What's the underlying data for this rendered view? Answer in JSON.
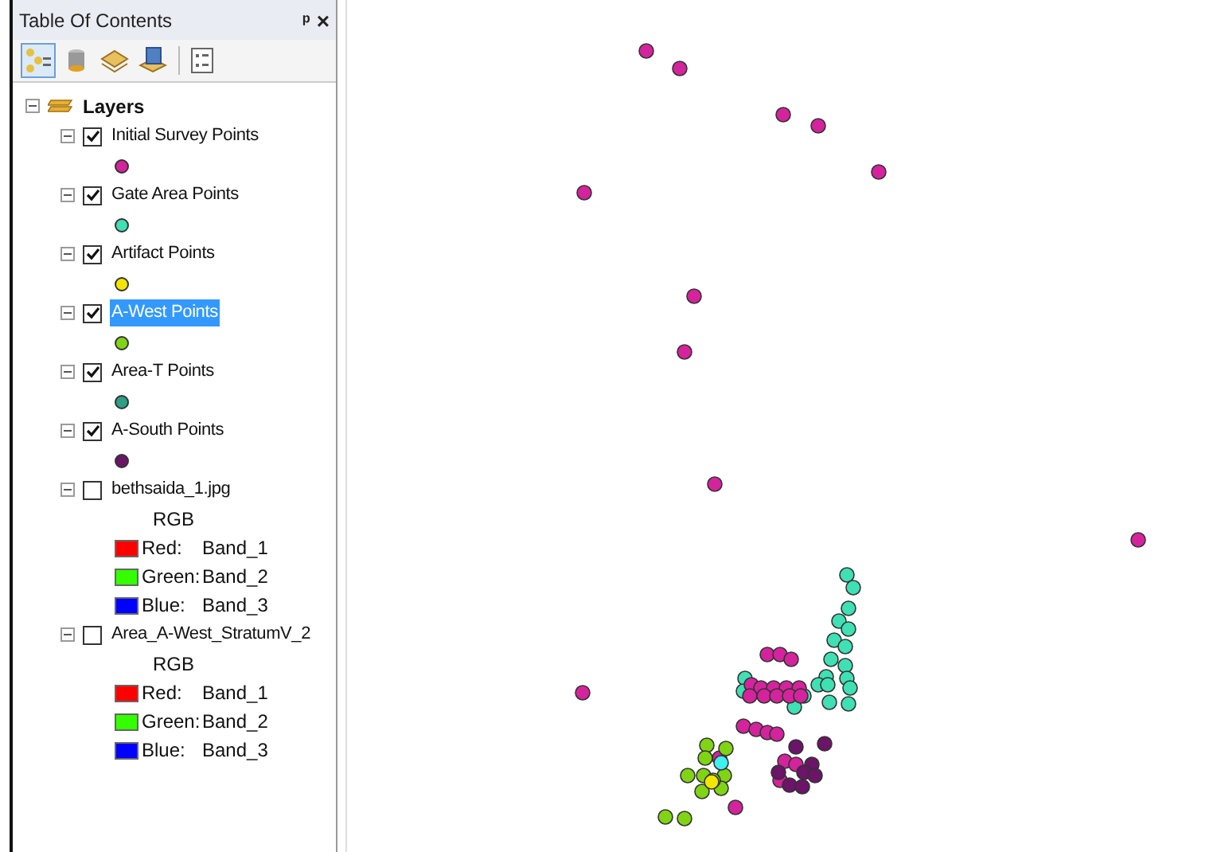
{
  "toc": {
    "title": "Table Of Contents",
    "pin": "ᵖ",
    "close": "×"
  },
  "toolbar": [
    {
      "kind": "list-by-drawing-order",
      "selected": true
    },
    {
      "kind": "list-by-source",
      "selected": false
    },
    {
      "kind": "list-by-visibility",
      "selected": false
    },
    {
      "kind": "list-by-selection",
      "selected": false
    },
    {
      "kind": "options",
      "selected": false
    }
  ],
  "root": {
    "label": "Layers",
    "expanded": true
  },
  "layers": [
    {
      "kind": "point",
      "label": "Initial Survey Points",
      "checked": true,
      "selected": false,
      "expanded": true,
      "color": "#d4239c"
    },
    {
      "kind": "point",
      "label": "Gate Area Points",
      "checked": true,
      "selected": false,
      "expanded": true,
      "color": "#3fe0b4"
    },
    {
      "kind": "point",
      "label": "Artifact Points",
      "checked": true,
      "selected": false,
      "expanded": true,
      "color": "#f2e600"
    },
    {
      "kind": "point",
      "label": "A-West Points",
      "checked": true,
      "selected": true,
      "expanded": true,
      "color": "#80d414"
    },
    {
      "kind": "point",
      "label": "Area-T Points",
      "checked": true,
      "selected": false,
      "expanded": true,
      "color": "#2e9e84"
    },
    {
      "kind": "point",
      "label": "A-South Points",
      "checked": true,
      "selected": false,
      "expanded": true,
      "color": "#6b1468"
    },
    {
      "kind": "raster",
      "label": "bethsaida_1.jpg",
      "checked": false,
      "selected": false,
      "expanded": true,
      "band_label": "RGB",
      "bands": [
        {
          "name": "Red:",
          "value": "Band_1",
          "color": "#ff0000"
        },
        {
          "name": "Green:",
          "value": "Band_2",
          "color": "#33ff00"
        },
        {
          "name": "Blue:",
          "value": "Band_3",
          "color": "#0000ff"
        }
      ]
    },
    {
      "kind": "raster",
      "label": "Area_A-West_StratumV_2",
      "checked": false,
      "selected": false,
      "expanded": true,
      "band_label": "RGB",
      "bands": [
        {
          "name": "Red:",
          "value": "Band_1",
          "color": "#ff0000"
        },
        {
          "name": "Green:",
          "value": "Band_2",
          "color": "#33ff00"
        },
        {
          "name": "Blue:",
          "value": "Band_3",
          "color": "#0000ff"
        }
      ]
    }
  ]
}
